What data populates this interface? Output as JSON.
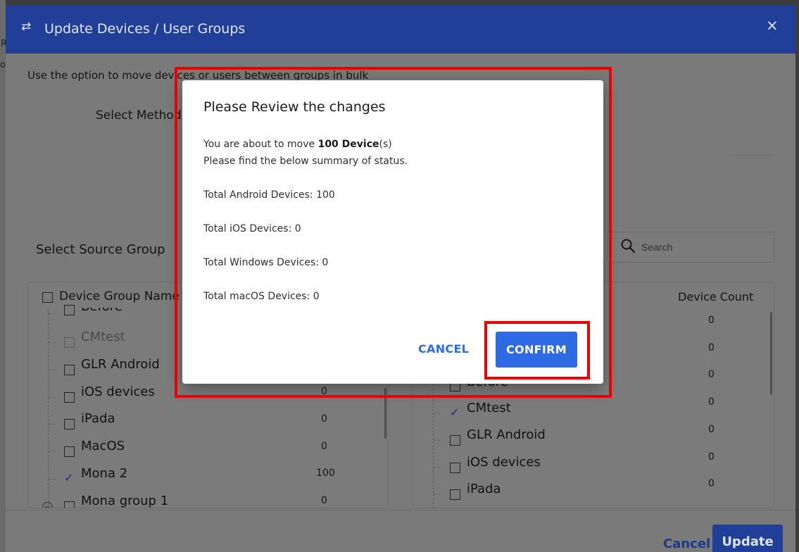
{
  "colors": {
    "header_bg": "#1f3f98",
    "primary_button": "#2d6be4",
    "highlight": "#ee0000",
    "overlay": "#7a7a7a"
  },
  "page_edge": {
    "fragments": [
      "R",
      "oi"
    ]
  },
  "dialog": {
    "title": "Update Devices / User Groups",
    "title_icon": "swap-arrows-icon",
    "close_icon": "close-icon",
    "close_glyph": "×",
    "subtitle": "Use the option to move devices or users between groups in bulk",
    "select_method_label": "Select Method",
    "select_source_label": "Select Source Group",
    "search": {
      "placeholder": "Search",
      "value": ""
    },
    "source_table": {
      "header_name": "Device Group Name",
      "rows": [
        {
          "label": "Before",
          "count": "",
          "checked": false
        },
        {
          "label": "CMtest",
          "count": "",
          "checked": false,
          "disabled": true
        },
        {
          "label": "GLR Android",
          "count": "",
          "checked": false
        },
        {
          "label": "iOS devices",
          "count": "0",
          "checked": false
        },
        {
          "label": "iPada",
          "count": "0",
          "checked": false
        },
        {
          "label": "MacOS",
          "count": "0",
          "checked": false
        },
        {
          "label": "Mona 2",
          "count": "100",
          "checked": true
        },
        {
          "label": "Mona group 1",
          "count": "0",
          "checked": false
        }
      ]
    },
    "destination_table": {
      "header_count": "Device Count",
      "counts": [
        "0",
        "0",
        "0",
        "0",
        "0",
        "0",
        "0"
      ],
      "rows": [
        {
          "label": "Before",
          "checked": false
        },
        {
          "label": "CMtest",
          "checked": true
        },
        {
          "label": "GLR Android",
          "checked": false
        },
        {
          "label": "iOS devices",
          "checked": false
        },
        {
          "label": "iPada",
          "checked": false
        }
      ]
    },
    "footer": {
      "cancel_label": "Cancel",
      "update_label": "Update"
    }
  },
  "review_modal": {
    "title": "Please Review the changes",
    "move_prefix": "You are about to move ",
    "move_bold": "100 Device",
    "move_suffix": "(s)",
    "summary_line": "Please find the below summary of status.",
    "android": "Total Android Devices: 100",
    "ios": "Total iOS Devices: 0",
    "windows": "Total Windows Devices: 0",
    "macos": "Total macOS Devices: 0",
    "cancel_label": "CANCEL",
    "confirm_label": "CONFIRM"
  }
}
